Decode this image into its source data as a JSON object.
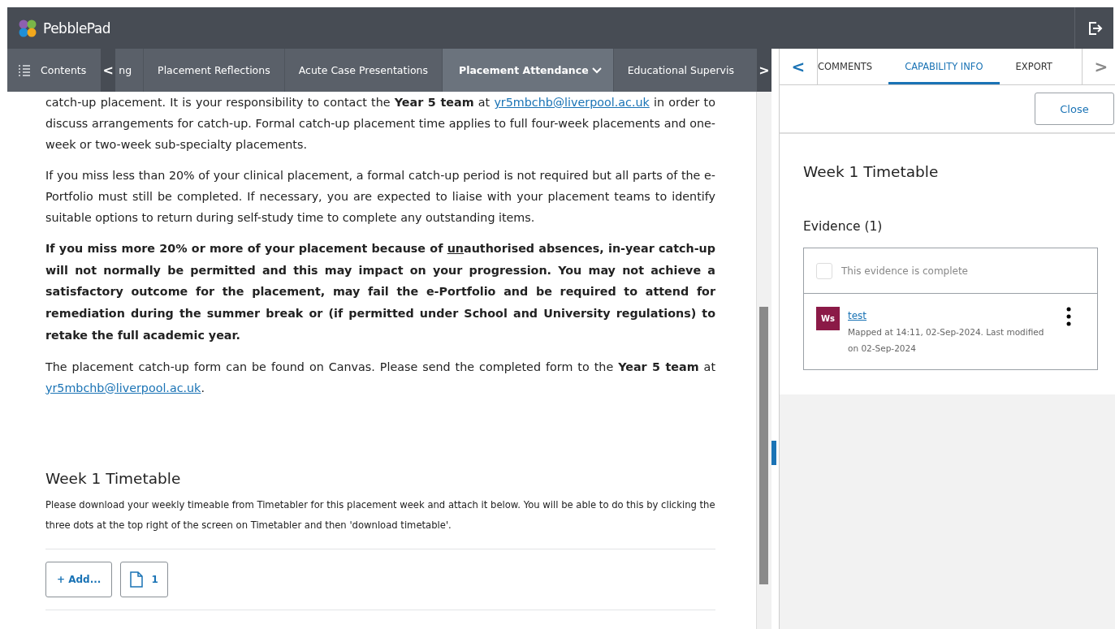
{
  "header": {
    "app_name": "PebblePad"
  },
  "nav": {
    "contents_label": "Contents",
    "prev_label": "<",
    "next_label": ">",
    "tabs": [
      {
        "label": "ng",
        "selected": false,
        "dropdown": false
      },
      {
        "label": "Placement Reflections",
        "selected": false,
        "dropdown": false
      },
      {
        "label": "Acute Case Presentations",
        "selected": false,
        "dropdown": false
      },
      {
        "label": "Placement Attendance",
        "selected": true,
        "dropdown": true
      },
      {
        "label": "Educational Supervis",
        "selected": false,
        "dropdown": false
      }
    ]
  },
  "content": {
    "paragraphs": [
      {
        "bold": false,
        "parts": [
          {
            "kind": "text",
            "text": "catch-up placement. It is your responsibility to contact the **Year 5 team** at "
          },
          {
            "kind": "link",
            "text": "yr5mbchb@liverpool.ac.uk"
          },
          {
            "kind": "text",
            "text": " in order to discuss arrangements for catch-up. Formal catch-up placement time applies to full four-week placements and one-week or two-week sub-specialty placements."
          }
        ]
      },
      {
        "bold": false,
        "parts": [
          {
            "kind": "text",
            "text": "If you miss less than 20% of your clinical placement, a formal catch-up period is not required but all parts of the e-Portfolio must still be completed. If necessary, you are expected to liaise with your placement teams to identify suitable options to return during self-study time to complete any outstanding items."
          }
        ]
      },
      {
        "bold": true,
        "parts": [
          {
            "kind": "text",
            "text": "If you miss more 20% or more of your placement because of "
          },
          {
            "kind": "underline",
            "text": "un"
          },
          {
            "kind": "text",
            "text": "authorised absences, in-year catch-up will not normally be permitted and this may impact on your progression. You may not achieve a satisfactory outcome for the placement, may fail the e-Portfolio and be required to attend for remediation during the summer break or (if permitted under School and University regulations) to retake the full academic year."
          }
        ]
      },
      {
        "bold": false,
        "parts": [
          {
            "kind": "text",
            "text": "The placement catch-up form can be found on Canvas. Please send the completed form to the **Year 5 team** at "
          },
          {
            "kind": "link",
            "text": "yr5mbchb@liverpool.ac.uk"
          },
          {
            "kind": "text",
            "text": "."
          }
        ]
      }
    ],
    "section": {
      "title": "Week 1 Timetable",
      "description": "Please download your weekly timeable from Timetabler for this placement week and attach it below. You will be able to do this by clicking the three dots at the top right of the screen on Timetabler and then 'download timetable'.",
      "add_label": "+ Add...",
      "file_count": "1"
    }
  },
  "panel": {
    "prev_label": "<",
    "next_label": ">",
    "tabs": [
      {
        "label": "COMMENTS",
        "selected": false
      },
      {
        "label": "CAPABILITY INFO",
        "selected": true
      },
      {
        "label": "EXPORT",
        "selected": false
      }
    ],
    "close_label": "Close",
    "title": "Week 1 Timetable",
    "evidence_heading": "Evidence (1)",
    "complete": {
      "label": "This evidence is complete",
      "checked": false
    },
    "items": [
      {
        "initials": "Ws",
        "color": "#8b1a47",
        "name": "test",
        "meta": "Mapped at 14:11, 02-Sep-2024. Last modified on 02-Sep-2024"
      }
    ]
  }
}
